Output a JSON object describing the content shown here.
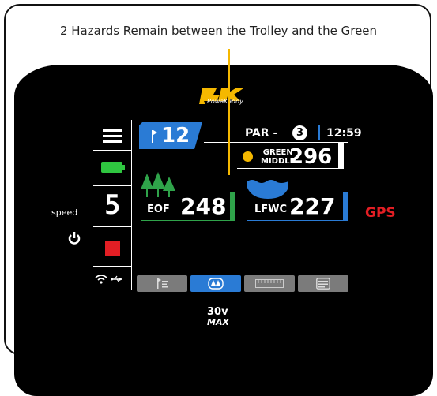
{
  "caption": "2 Hazards Remain between the Trolley and the Green",
  "brand": {
    "logo_text": "PK",
    "logo_sub": "PowaKaddy"
  },
  "hole": {
    "number": "12"
  },
  "par": {
    "label": "PAR -",
    "value": "3"
  },
  "time": "12:59",
  "green": {
    "label_line1": "GREEN",
    "label_line2": "MIDDLE",
    "distance": "296"
  },
  "hazards": [
    {
      "label": "EOF",
      "distance": "248",
      "color": "#2fa34a",
      "icon": "trees-icon"
    },
    {
      "label": "LFWC",
      "distance": "227",
      "color": "#2a7bd5",
      "icon": "water-icon"
    }
  ],
  "gps_label": "GPS",
  "speed": {
    "label": "speed",
    "value": "5"
  },
  "model": {
    "line1": "30v",
    "line2": "MAX"
  },
  "colors": {
    "accent_blue": "#2a7bd5",
    "battery_green": "#2fc640",
    "stop_red": "#e31e24",
    "pointer_yellow": "#f5b800"
  },
  "tabs": [
    {
      "icon": "hole-flag-icon",
      "active": false
    },
    {
      "icon": "hazard-view-icon",
      "active": true
    },
    {
      "icon": "ruler-icon",
      "active": false
    },
    {
      "icon": "scorecard-icon",
      "active": false
    }
  ]
}
